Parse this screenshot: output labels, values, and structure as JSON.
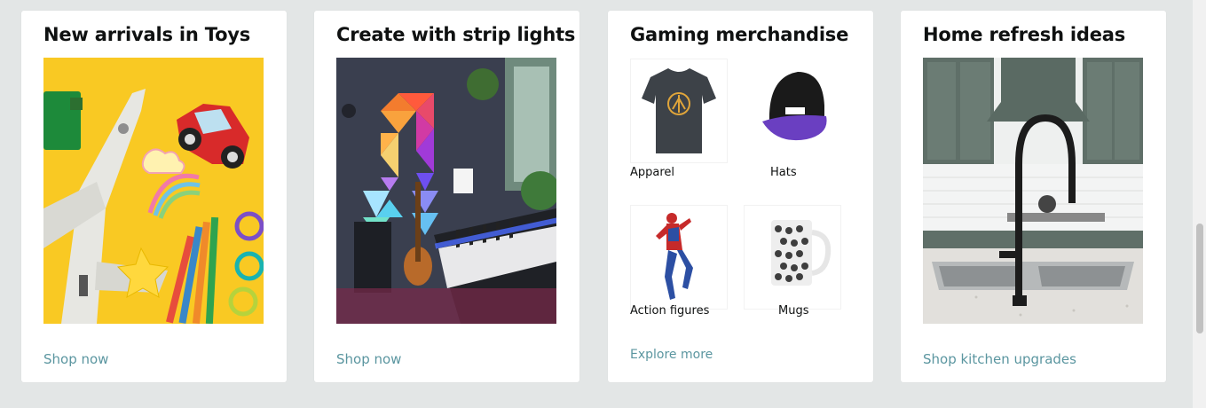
{
  "cards": [
    {
      "title": "New arrivals in Toys",
      "link": "Shop now",
      "image_icon": "toys-flatlay-image"
    },
    {
      "title": "Create with strip lights",
      "link": "Shop now",
      "image_icon": "strip-lights-room-image"
    },
    {
      "title": "Gaming merchandise",
      "link": "Explore more",
      "items": [
        {
          "label": "Apparel",
          "icon": "tshirt-image"
        },
        {
          "label": "Hats",
          "icon": "cap-image"
        },
        {
          "label": "Action figures",
          "icon": "spiderman-figure-image"
        },
        {
          "label": "Mugs",
          "icon": "mug-image"
        }
      ]
    },
    {
      "title": "Home refresh ideas",
      "link": "Shop kitchen upgrades",
      "image_icon": "kitchen-faucet-image"
    }
  ],
  "colors": {
    "page_background": "#e3e6e6",
    "card_background": "#ffffff",
    "link": "#5b96a0",
    "title": "#0f1111"
  }
}
